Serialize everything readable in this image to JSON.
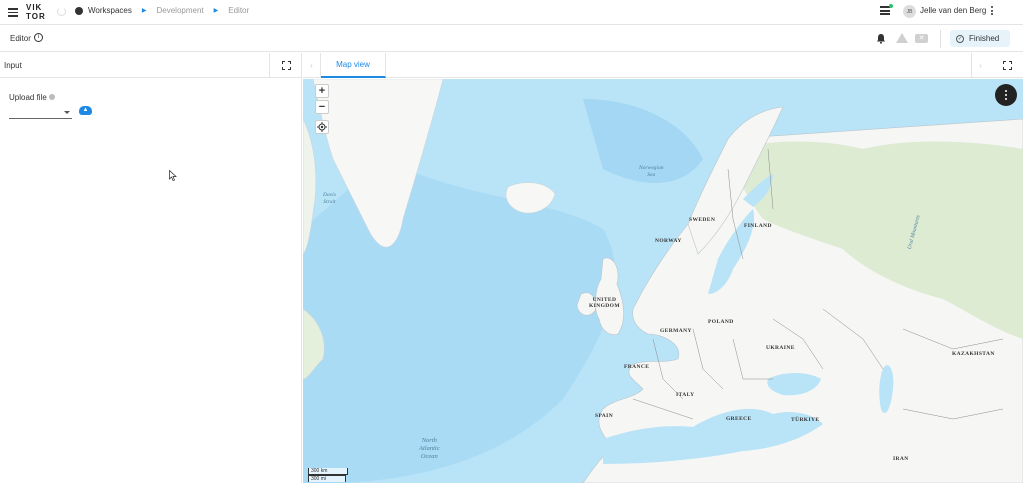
{
  "topbar": {
    "logo_line1": "VIK",
    "logo_line2": "TOR",
    "breadcrumbs": [
      "Workspaces",
      "Development",
      "Editor"
    ],
    "user_initials": "JB",
    "user_name": "Jelle van den Berg"
  },
  "editorbar": {
    "title": "Editor",
    "status_label": "Finished"
  },
  "leftpane": {
    "header": "Input",
    "upload_label": "Upload file"
  },
  "rightpane": {
    "tab_label": "Map view"
  },
  "map": {
    "zoom_in": "+",
    "zoom_out": "−",
    "scale_km": "300 km",
    "scale_mi": "300 mi",
    "labels": {
      "sweden": "SWEDEN",
      "finland": "FINLAND",
      "norway": "NORWAY",
      "uk1": "UNITED",
      "uk2": "KINGDOM",
      "germany": "GERMANY",
      "poland": "POLAND",
      "ukraine": "UKRAINE",
      "kazakhstan": "KAZAKHSTAN",
      "france": "FRANCE",
      "italy": "ITALY",
      "spain": "SPAIN",
      "greece": "GREECE",
      "turkiye": "TÜRKIYE",
      "iran": "IRAN",
      "ural": "Ural Mountains",
      "norwegian1": "Norwegian",
      "norwegian2": "Sea",
      "davis1": "Davis",
      "davis2": "Strait",
      "atlantic1": "North",
      "atlantic2": "Atlantic",
      "atlantic3": "Ocean"
    }
  },
  "colors": {
    "accent": "#1e88e5",
    "status_ok_bg": "#e6f3fb",
    "sea": "#b9e3f7",
    "land": "#f6f6f4",
    "forest": "#dcebd2"
  }
}
